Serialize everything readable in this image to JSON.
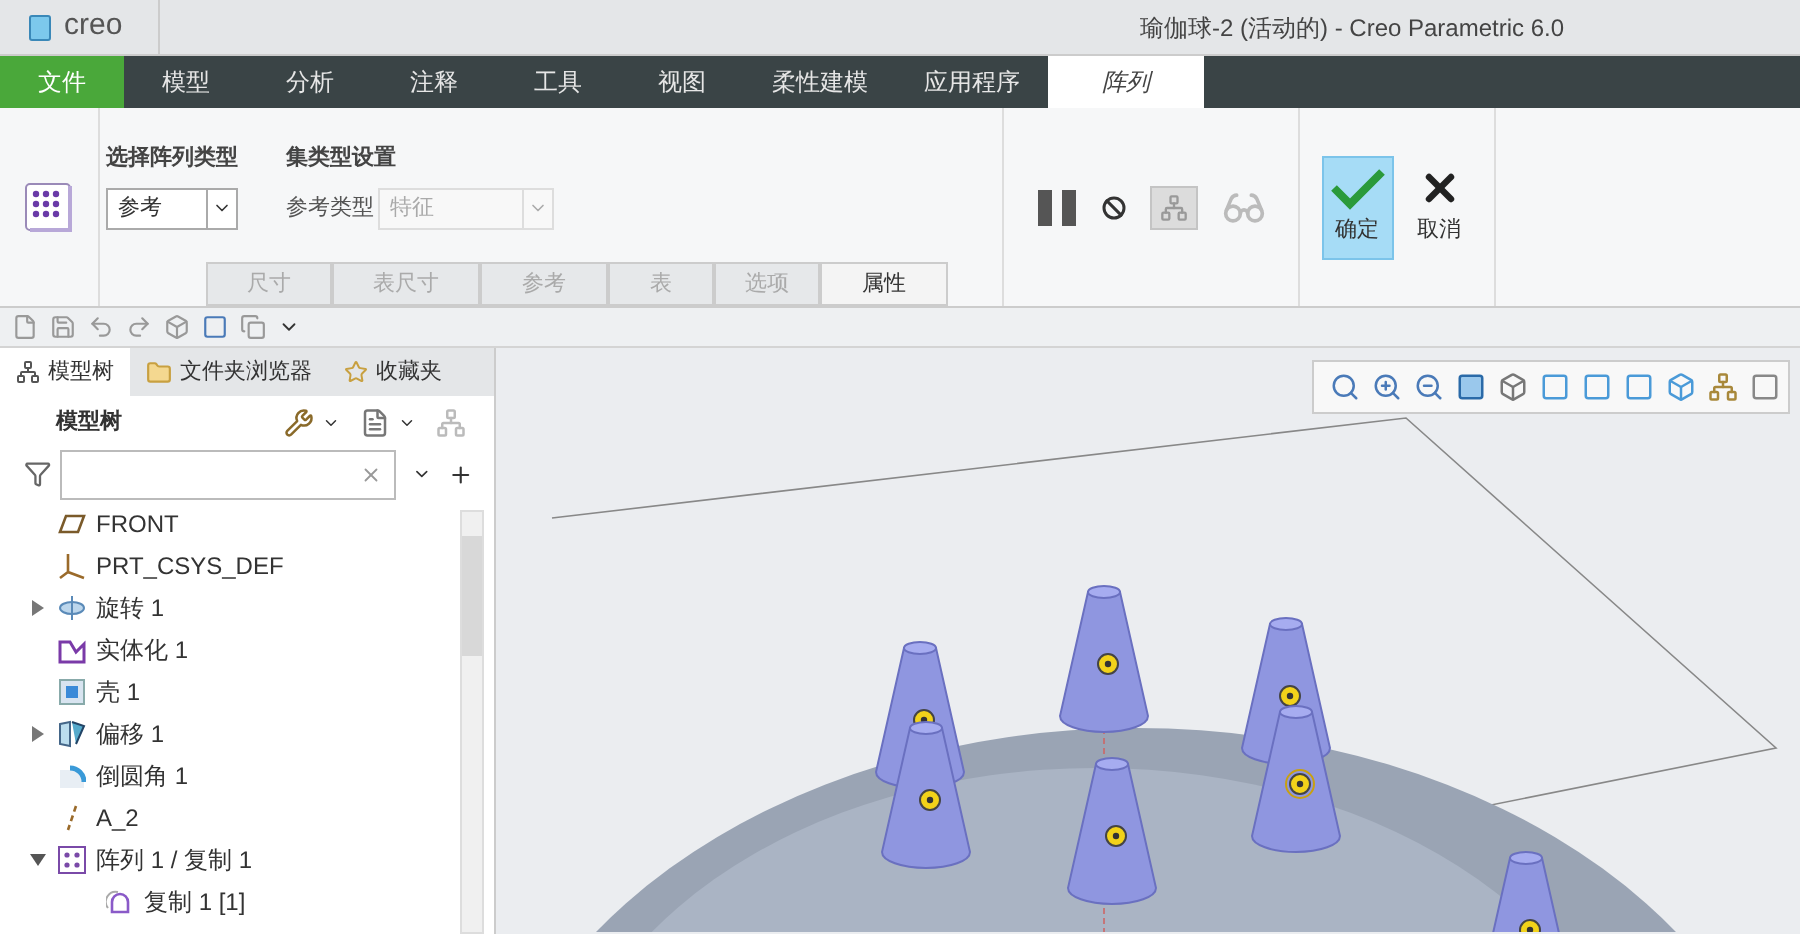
{
  "window": {
    "logo": "creo",
    "title": "瑜伽球-2 (活动的) - Creo Parametric 6.0"
  },
  "menu_tabs": [
    {
      "label": "文件",
      "kind": "file",
      "selected": false
    },
    {
      "label": "模型",
      "kind": "tab",
      "selected": false
    },
    {
      "label": "分析",
      "kind": "tab",
      "selected": false
    },
    {
      "label": "注释",
      "kind": "tab",
      "selected": false
    },
    {
      "label": "工具",
      "kind": "tab",
      "selected": false
    },
    {
      "label": "视图",
      "kind": "tab",
      "selected": false
    },
    {
      "label": "柔性建模",
      "kind": "tab",
      "selected": false
    },
    {
      "label": "应用程序",
      "kind": "tab",
      "selected": false
    },
    {
      "label": "阵列",
      "kind": "tab",
      "selected": true
    }
  ],
  "ribbon": {
    "pattern_type": {
      "label": "选择阵列类型",
      "value": "参考"
    },
    "set_type": {
      "label": "集类型设置",
      "field_label": "参考类型",
      "value": "特征",
      "disabled": true
    },
    "sub_tabs": [
      {
        "label": "尺寸",
        "selected": false
      },
      {
        "label": "表尺寸",
        "selected": false
      },
      {
        "label": "参考",
        "selected": false
      },
      {
        "label": "表",
        "selected": false
      },
      {
        "label": "选项",
        "selected": false
      },
      {
        "label": "属性",
        "selected": true
      }
    ],
    "ok": "确定",
    "cancel": "取消"
  },
  "panel_tabs": [
    {
      "label": "模型树",
      "kind": "tree",
      "selected": true
    },
    {
      "label": "文件夹浏览器",
      "kind": "folder",
      "selected": false
    },
    {
      "label": "收藏夹",
      "kind": "favorites",
      "selected": false
    }
  ],
  "model_tree": {
    "title": "模型树",
    "items": [
      {
        "label": "FRONT",
        "kind": "plane"
      },
      {
        "label": "PRT_CSYS_DEF",
        "kind": "csys"
      },
      {
        "label": "旋转 1",
        "kind": "revolve",
        "expanded": false
      },
      {
        "label": "实体化 1",
        "kind": "solidify"
      },
      {
        "label": "壳 1",
        "kind": "shell"
      },
      {
        "label": "偏移 1",
        "kind": "offset",
        "expanded": false
      },
      {
        "label": "倒圆角 1",
        "kind": "round"
      },
      {
        "label": "A_2",
        "kind": "axis"
      },
      {
        "label": "阵列 1 / 复制 1",
        "kind": "pattern",
        "expanded": true,
        "children": [
          {
            "label": "复制 1 [1]",
            "kind": "copy"
          }
        ]
      }
    ]
  }
}
